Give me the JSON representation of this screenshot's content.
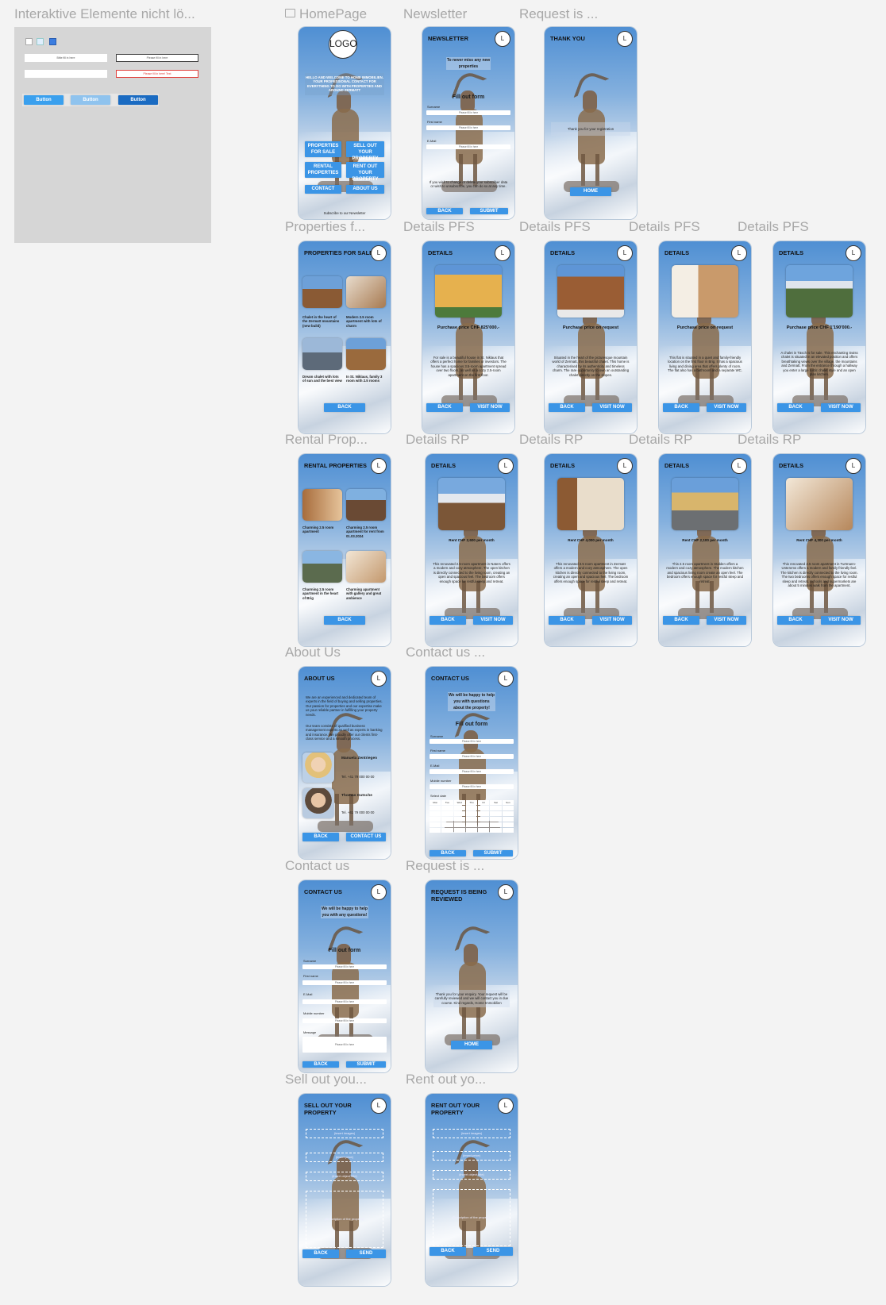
{
  "colors": {
    "canvas": "#f3f3f3",
    "accent": "#3b95e6",
    "panel": "#d6d6d6",
    "label": "#a8a8a8",
    "error": "#e0403c"
  },
  "labels": {
    "interactive": "Interaktive Elemente nicht lö...",
    "homepage": "HomePage",
    "newsletter": "Newsletter",
    "request_top": "Request is ...",
    "pfs": "Properties f...",
    "details_pfs_1": "Details PFS",
    "details_pfs_2": "Details PFS",
    "details_pfs_3": "Details PFS",
    "details_pfs_4": "Details PFS",
    "rental": "Rental Prop...",
    "details_rp_1": "Details RP",
    "details_rp_2": "Details RP",
    "details_rp_3": "Details RP",
    "details_rp_4": "Details RP",
    "about": "About Us",
    "contact_top": "Contact us ...",
    "contact": "Contact us",
    "request_mid": "Request is ...",
    "sell": "Sell out you...",
    "rent": "Rent out yo..."
  },
  "panel": {
    "field_1": "Bitte fill in here",
    "field_2": "Please fill in here",
    "field_error": "Please fill in here! Text",
    "btn_1": "Button",
    "btn_2": "Button",
    "btn_3": "Button"
  },
  "home": {
    "logo": "LOGO",
    "welcome": "HELLO AND WELCOME TO HOME IMMOBILIEN. YOUR PROFESSIONAL CONTACT FOR EVERYTHING TO DO WITH PROPERTIES AND AROUND ZERMATT",
    "buttons": [
      "PROPERTIES FOR SALE",
      "SELL OUT YOUR PROPERTY",
      "RENTAL PROPERTIES",
      "RENT OUT YOUR PROPERTY",
      "CONTACT",
      "ABOUT US"
    ],
    "footer": "Subscribe to our Newsletter"
  },
  "newsletter": {
    "title": "NEWSLETTER",
    "intro": "To never miss any new properties",
    "form": "Fill out form",
    "fields": [
      "Surname",
      "First name",
      "E-Mail"
    ],
    "placeholder": "Please fill in here",
    "disclaimer": "If you wish to change or delete your subscriber data or wish to unsubscribe, you can do so at any time.",
    "back": "BACK",
    "submit": "SUBMIT"
  },
  "thankyou": {
    "title": "THANK YOU",
    "text": "Thank you for your registration",
    "home": "HOME"
  },
  "pfs": {
    "title": "PROPERTIES FOR SALE",
    "items": [
      "Chalet in the heart of the Zermatt mountains (new build)",
      "Modern 2.5 room apartment with lots of charm",
      "Dream chalet with lots of sun and the best view",
      "In St. Niklaus, family 3 room with 2.5 rooms"
    ],
    "back": "BACK"
  },
  "details_pfs": [
    {
      "title": "DETAILS",
      "price": "Purchase price CHF 825'000.-",
      "text": "For sale is a beautiful house in St. Niklaus that offers a perfect home for families or investors. The house has a spacious 3.5-room apartment spread over two floors, as well as a cozy 2.5-room apartment on the first floor.",
      "back": "BACK",
      "visit": "VISIT NOW"
    },
    {
      "title": "DETAILS",
      "price": "Purchase price on request",
      "text": "Situated in the heart of the picturesque mountain world of Zermatt, this beautiful chalet. This home is characterised by its authenticity and timeless charm. The rare opportunity to own an outstanding chalet directly on the slopes.",
      "back": "BACK",
      "visit": "VISIT NOW"
    },
    {
      "title": "DETAILS",
      "price": "Purchase price on request",
      "text": "This flat is situated in a quiet and family-friendly location on the first floor in Brig. It has a spacious living and dining area that offers plenty of room. The flat also has a bathroom and a separate WC.",
      "back": "BACK",
      "visit": "VISIT NOW"
    },
    {
      "title": "DETAILS",
      "price": "Purchase price CHF 1'190'000.-",
      "text": "A chalet in Täsch is for sale. This enchanting Swiss chalet is situated in an elevated position and offers breathtaking views over the village, the mountains and Zermatt. From the entrance through a hallway you enter a large rustic chalet style and an open plan kitchen.",
      "back": "BACK",
      "visit": "VISIT NOW"
    }
  ],
  "rental": {
    "title": "RENTAL PROPERTIES",
    "items": [
      "Charming 2.5 room apartment",
      "Charming 2.5 room apartment for rent from 01.03.2024",
      "Charming 2.5 room apartment in the heart of Brig",
      "Charming apartment with gallery and great ambience"
    ],
    "back": "BACK"
  },
  "details_rp": [
    {
      "title": "DETAILS",
      "price": "Rent CHF 2,600 per month",
      "text": "This renovated 2.5-room apartment in Naters offers a modern and cozy atmosphere. The open kitchen is directly connected to the living room, creating an open and spacious feel. The bedroom offers enough space for restful sleep and retreat.",
      "back": "BACK",
      "visit": "VISIT NOW"
    },
    {
      "title": "DETAILS",
      "price": "Rent CHF 4,000 per month",
      "text": "This renovated 3.5 room apartment in Zermatt offers a modern and cozy atmosphere. The open kitchen is directly connected to the living room, creating an open and spacious feel. The bedroom offers enough space for restful sleep and retreat.",
      "back": "BACK",
      "visit": "VISIT NOW"
    },
    {
      "title": "DETAILS",
      "price": "Rent CHF 2,100 per month",
      "text": "This 2.5 room apartment in Stalden offers a modern and cozy atmosphere. The modern kitchen and spacious living room create an open feel. The bedroom offers enough space for restful sleep and retreat.",
      "back": "BACK",
      "visit": "VISIT NOW"
    },
    {
      "title": "DETAILS",
      "price": "Rent CHF 4,300 per month",
      "text": "This renovated 4.5 room apartment in Turtmann-Unterems offers a modern and family friendly feel. The kitchen is directly connected to the living room. The two bedrooms offers enough space for restful sleep and retreat. Schools and supermarkets are about 5 minutes walk from the apartment.",
      "back": "BACK",
      "visit": "VISIT NOW"
    }
  ],
  "about": {
    "title": "ABOUT US",
    "intro": "We are an experienced and dedicated team of experts in the field of buying and selling properties. Our passion for properties and our expertise make us your reliable partner in fulfilling your property needs.",
    "intro2": "Our team consists of qualified business management experts as well as experts in banking and insurance. We proudly offer our clients first-class service and a smooth process.",
    "person_1": "Manuela Zentriegen",
    "person_1_tel": "Tel. +41 79 000 00 00",
    "person_2": "Thomas Gutsche",
    "person_2_tel": "Tel. +41 79 000 00 00",
    "back": "BACK",
    "contact": "CONTACT US"
  },
  "contact_cal": {
    "title": "CONTACT US",
    "intro": "We will be happy to help you with questions about the property!",
    "form": "Fill out form",
    "fields": [
      "Surname",
      "First name",
      "E-Mail",
      "Mobile number",
      "Select date"
    ],
    "placeholder": "Please fill in here",
    "days": [
      "Mon",
      "Tue",
      "Wed",
      "Thu",
      "Fri",
      "Sat",
      "Sun"
    ],
    "back": "BACK",
    "submit": "SUBMIT"
  },
  "contact": {
    "title": "CONTACT US",
    "intro": "We will be happy to help you with any questions!",
    "form": "Fill out form",
    "fields": [
      "Surname",
      "First name",
      "E-Mail",
      "Mobile number",
      "Message"
    ],
    "placeholder": "Please fill in here",
    "back": "BACK",
    "submit": "SUBMIT"
  },
  "review": {
    "title": "REQUEST IS BEING REVIEWED",
    "text": "Thank you for your enquiry. Your request will be carefully reviewed and we will contact you in due course. Kind regards, Home Immobilien",
    "home": "HOME"
  },
  "sell": {
    "title": "SELL OUT YOUR PROPERTY",
    "boxes": [
      "(insert images)",
      "(insert price)",
      "(insert object title)",
      "(Description of the property)"
    ],
    "back": "BACK",
    "send": "SEND"
  },
  "rent": {
    "title": "RENT OUT YOUR PROPERTY",
    "boxes": [
      "(insert images)",
      "(insert price)",
      "(insert object title)",
      "(Description of the property)"
    ],
    "back": "BACK",
    "send": "SEND"
  }
}
